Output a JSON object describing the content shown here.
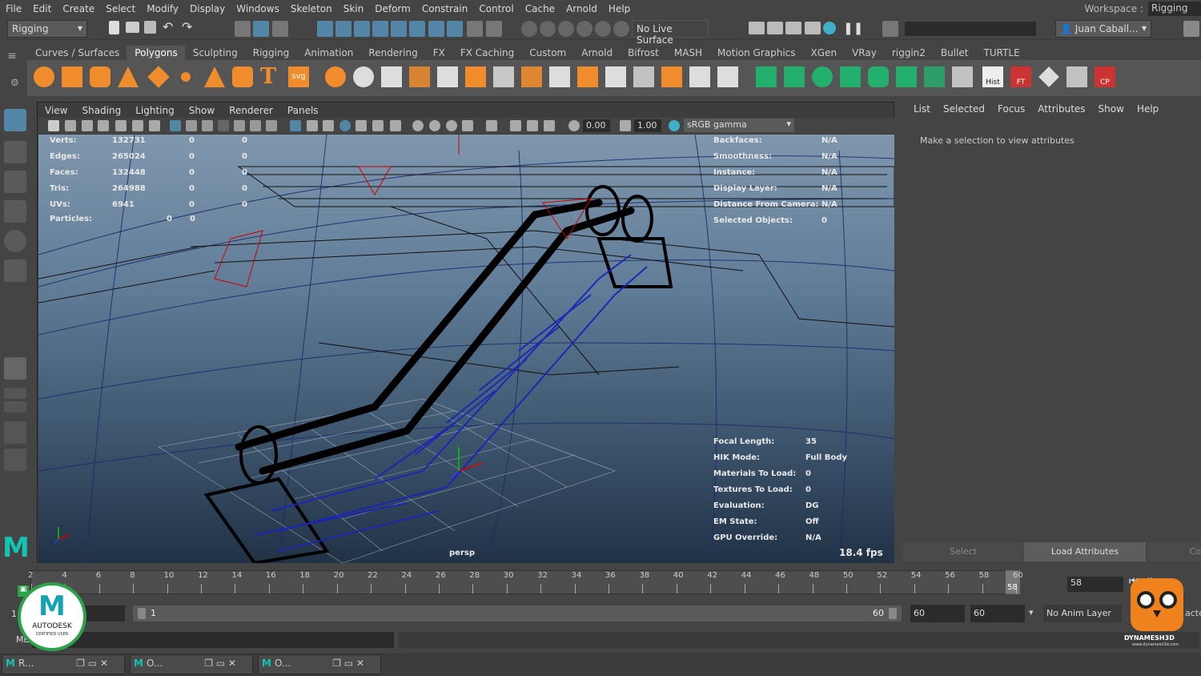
{
  "menubar": {
    "items": [
      "File",
      "Edit",
      "Create",
      "Select",
      "Modify",
      "Display",
      "Windows",
      "Skeleton",
      "Skin",
      "Deform",
      "Constrain",
      "Control",
      "Cache",
      "Arnold",
      "Help"
    ]
  },
  "workspace": {
    "label": "Workspace :",
    "value": "Rigging"
  },
  "statusline": {
    "mode": "Rigging",
    "live_surface": "No Live Surface",
    "user": "Juan Caball..."
  },
  "shelf": {
    "tabs": [
      "Curves / Surfaces",
      "Polygons",
      "Sculpting",
      "Rigging",
      "Animation",
      "Rendering",
      "FX",
      "FX Caching",
      "Custom",
      "Arnold",
      "Bifrost",
      "MASH",
      "Motion Graphics",
      "XGen",
      "VRay",
      "riggin2",
      "Bullet",
      "TURTLE"
    ],
    "active_tab": "Polygons",
    "labels": {
      "hist": "Hist",
      "ft": "FT",
      "cp": "CP",
      "svg": "svg",
      "text": "T"
    }
  },
  "viewport": {
    "menu": [
      "View",
      "Shading",
      "Lighting",
      "Show",
      "Renderer",
      "Panels"
    ],
    "exposure": "0.00",
    "gamma": "1.00",
    "colorspace": "sRGB gamma",
    "camera": "persp",
    "fps": "18.4 fps",
    "hud_left": [
      {
        "label": "Verts:",
        "v1": "132731",
        "v2": "0",
        "v3": "0"
      },
      {
        "label": "Edges:",
        "v1": "265024",
        "v2": "0",
        "v3": "0"
      },
      {
        "label": "Faces:",
        "v1": "132448",
        "v2": "0",
        "v3": "0"
      },
      {
        "label": "Tris:",
        "v1": "264988",
        "v2": "0",
        "v3": "0"
      },
      {
        "label": "UVs:",
        "v1": "6941",
        "v2": "0",
        "v3": "0"
      }
    ],
    "particles": {
      "label": "Particles:",
      "v1": "0",
      "v2": "0"
    },
    "hud_right_top": [
      {
        "label": "Backfaces:",
        "value": "N/A"
      },
      {
        "label": "Smoothness:",
        "value": "N/A"
      },
      {
        "label": "Instance:",
        "value": "N/A"
      },
      {
        "label": "Display Layer:",
        "value": "N/A"
      },
      {
        "label": "Distance From Camera:",
        "value": "N/A"
      },
      {
        "label": "Selected Objects:",
        "value": "0"
      }
    ],
    "hud_right_bottom": [
      {
        "label": "Focal Length:",
        "value": "35"
      },
      {
        "label": "HIK Mode:",
        "value": "Full Body"
      },
      {
        "label": "Materials To Load:",
        "value": "0"
      },
      {
        "label": "Textures To Load:",
        "value": "0"
      },
      {
        "label": "Evaluation:",
        "value": "DG"
      },
      {
        "label": "EM State:",
        "value": "Off"
      },
      {
        "label": "GPU Override:",
        "value": "N/A"
      }
    ]
  },
  "attribute_editor": {
    "menu": [
      "List",
      "Selected",
      "Focus",
      "Attributes",
      "Show",
      "Help"
    ],
    "message": "Make a selection to view attributes",
    "select_button": "Select",
    "load_button": "Load Attributes",
    "copy_button": "Co"
  },
  "timeline": {
    "ticks": [
      "2",
      "4",
      "6",
      "8",
      "10",
      "12",
      "14",
      "16",
      "18",
      "20",
      "22",
      "24",
      "26",
      "28",
      "30",
      "32",
      "34",
      "36",
      "38",
      "40",
      "42",
      "44",
      "46",
      "48",
      "50",
      "52",
      "54",
      "56",
      "58",
      "60"
    ],
    "current_frame": "58",
    "current_field": "58"
  },
  "range": {
    "start": "1",
    "slider_start": "1",
    "slider_end": "60",
    "end": "60",
    "anim_end": "60",
    "anim_layer": "No Anim Layer",
    "char_set": "acte"
  },
  "cmdline": {
    "label": "ME"
  },
  "badge": {
    "line1": "AUTODESK",
    "line2": "CERTIFIED USER",
    "letter": "M"
  },
  "watermark": {
    "name": "DYNAMESH3D",
    "url": "www.dynamesh3d.com"
  },
  "taskbar": {
    "items": [
      "R...",
      "O...",
      "O..."
    ]
  },
  "colors": {
    "accent": "#5285a6",
    "shelf_orange": "#f08c2c",
    "shelf_green": "#23b06c",
    "maya_logo": "#14c3b4",
    "hud_text": "#e8e8e8"
  }
}
